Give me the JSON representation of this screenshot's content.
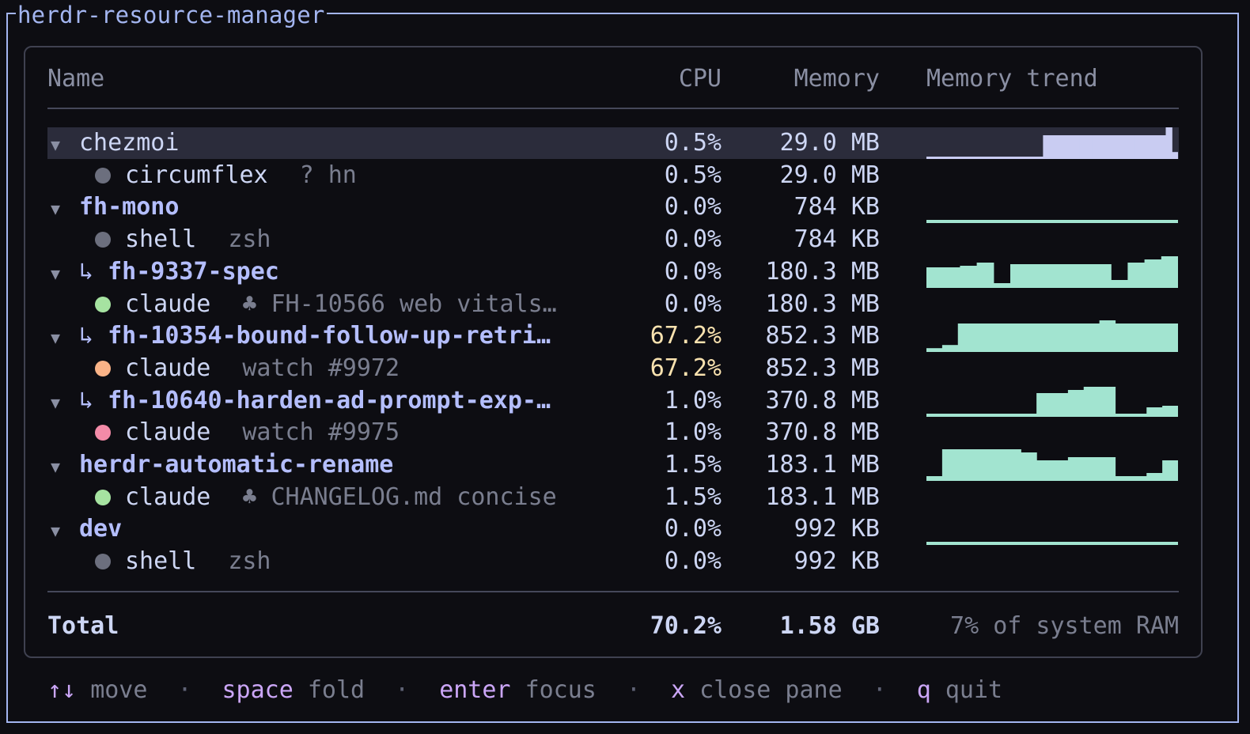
{
  "window_title": "herdr-resource-manager",
  "columns": {
    "name": "Name",
    "cpu": "CPU",
    "memory": "Memory",
    "trend": "Memory trend"
  },
  "rows": [
    {
      "kind": "group",
      "name": "chezmoi",
      "cpu": "0.5%",
      "memory": "29.0 MB",
      "selected": true,
      "plain": true,
      "trend": [
        0,
        0,
        0,
        0,
        0,
        0,
        0,
        0,
        0,
        0,
        0,
        0,
        0,
        0,
        0,
        0,
        0,
        0,
        0,
        0.75,
        0.75,
        0.75,
        0.75,
        0.75,
        0.75,
        0.75,
        0.75,
        0.75,
        0.75,
        0.75,
        0.75,
        0.75,
        0.75,
        0.75,
        0.75,
        0.75,
        0.75,
        0.75,
        0.75,
        1,
        0.22
      ]
    },
    {
      "kind": "pane",
      "name": "circumflex",
      "detail": "? hn",
      "dot": "#6c6f7e",
      "cpu": "0.5%",
      "memory": "29.0 MB"
    },
    {
      "kind": "group",
      "name": "fh-mono",
      "cpu": "0.0%",
      "memory": "784 KB",
      "trend": [
        0.1
      ]
    },
    {
      "kind": "pane",
      "name": "shell",
      "detail": "zsh",
      "dot": "#6c6f7e",
      "cpu": "0.0%",
      "memory": "784 KB"
    },
    {
      "kind": "group",
      "name": "fh-9337-spec",
      "branch": "↳",
      "cpu": "0.0%",
      "memory": "180.3 MB",
      "trend": [
        0.65,
        0.65,
        0.7,
        0.8,
        0.15,
        0.75,
        0.75,
        0.75,
        0.75,
        0.75,
        0.75,
        0.25,
        0.8,
        0.9,
        1.0
      ]
    },
    {
      "kind": "pane",
      "name": "claude",
      "detail": "♣ FH-10566 web vitals…",
      "dot": "#a6e3a1",
      "cpu": "0.0%",
      "memory": "180.3 MB"
    },
    {
      "kind": "group",
      "name": "fh-10354-bound-follow-up-retri…",
      "branch": "↳",
      "cpu": "67.2%",
      "memory": "852.3 MB",
      "hot": true,
      "trend": [
        0.12,
        0.22,
        0.9,
        0.9,
        0.9,
        0.9,
        0.9,
        0.9,
        0.9,
        0.9,
        0.9,
        1.0,
        0.9,
        0.9,
        0.9,
        0.9
      ]
    },
    {
      "kind": "pane",
      "name": "claude",
      "detail": "watch #9972",
      "dot": "#fab387",
      "cpu": "67.2%",
      "memory": "852.3 MB",
      "hot": true
    },
    {
      "kind": "group",
      "name": "fh-10640-harden-ad-prompt-exp-…",
      "branch": "↳",
      "cpu": "1.0%",
      "memory": "370.8 MB",
      "trend": [
        0.1,
        0.1,
        0.1,
        0.1,
        0.1,
        0.1,
        0.1,
        0.75,
        0.75,
        0.85,
        0.95,
        0.95,
        0.1,
        0.1,
        0.3,
        0.35
      ]
    },
    {
      "kind": "pane",
      "name": "claude",
      "detail": "watch #9975",
      "dot": "#f38ba8",
      "cpu": "1.0%",
      "memory": "370.8 MB"
    },
    {
      "kind": "group",
      "name": "herdr-automatic-rename",
      "cpu": "1.5%",
      "memory": "183.1 MB",
      "trend": [
        0.15,
        1.0,
        1.0,
        1.0,
        1.0,
        1.0,
        0.9,
        0.65,
        0.65,
        0.75,
        0.75,
        0.75,
        0.15,
        0.15,
        0.25,
        0.65
      ]
    },
    {
      "kind": "pane",
      "name": "claude",
      "detail": "♣ CHANGELOG.md concise",
      "dot": "#a6e3a1",
      "cpu": "1.5%",
      "memory": "183.1 MB"
    },
    {
      "kind": "group",
      "name": "dev",
      "cpu": "0.0%",
      "memory": "992 KB",
      "trend": [
        0.1
      ]
    },
    {
      "kind": "pane",
      "name": "shell",
      "detail": "zsh",
      "dot": "#6c6f7e",
      "cpu": "0.0%",
      "memory": "992 KB"
    }
  ],
  "total": {
    "label": "Total",
    "cpu": "70.2%",
    "memory": "1.58 GB",
    "system_ram": "7% of system RAM"
  },
  "footer": [
    {
      "key": "↑↓",
      "desc": "move"
    },
    {
      "key": "space",
      "desc": "fold"
    },
    {
      "key": "enter",
      "desc": "focus"
    },
    {
      "key": "x",
      "desc": "close pane"
    },
    {
      "key": "q",
      "desc": "quit"
    }
  ],
  "footer_separator": "·",
  "group_arrow": "▼",
  "colors": {
    "trend_selected": "#c9ccf2",
    "trend": "#a2e4d0",
    "accent": "#b4befe",
    "key": "#cba6f7",
    "hot": "#f9e2af"
  }
}
